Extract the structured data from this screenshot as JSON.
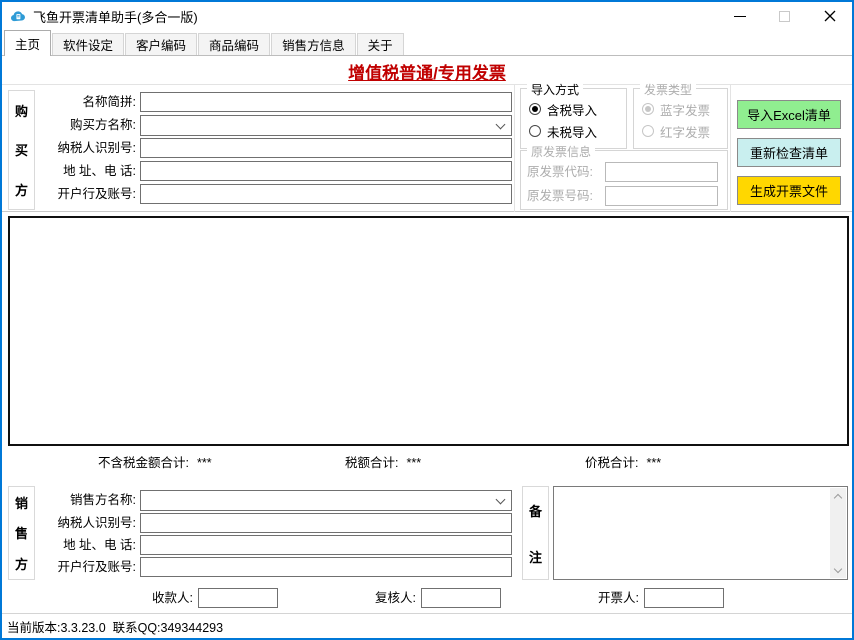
{
  "window": {
    "title": "飞鱼开票清单助手(多合一版)"
  },
  "colors": {
    "accent_border": "#0078D7",
    "heading_red": "#C00000",
    "button_green": "#90EE90",
    "button_cyan": "#C9EFEF",
    "button_gold": "#FFD700"
  },
  "tabs": [
    {
      "label": "主页",
      "active": true
    },
    {
      "label": "软件设定",
      "active": false
    },
    {
      "label": "客户编码",
      "active": false
    },
    {
      "label": "商品编码",
      "active": false
    },
    {
      "label": "销售方信息",
      "active": false
    },
    {
      "label": "关于",
      "active": false
    }
  ],
  "main": {
    "heading": "增值税普通/专用发票",
    "buyer": {
      "side_chars": [
        "购",
        "买",
        "方"
      ],
      "fields": [
        {
          "label": "名称简拼:",
          "value": ""
        },
        {
          "label": "购买方名称:",
          "value": ""
        },
        {
          "label": "纳税人识别号:",
          "value": ""
        },
        {
          "label": "地 址、电 话:",
          "value": ""
        },
        {
          "label": "开户行及账号:",
          "value": ""
        }
      ]
    },
    "import_mode": {
      "title": "导入方式",
      "options": [
        {
          "label": "含税导入",
          "selected": true
        },
        {
          "label": "未税导入",
          "selected": false
        }
      ]
    },
    "invoice_type": {
      "title": "发票类型",
      "disabled": true,
      "options": [
        {
          "label": "蓝字发票",
          "selected": true
        },
        {
          "label": "红字发票",
          "selected": false
        }
      ]
    },
    "original_invoice": {
      "title": "原发票信息",
      "disabled": true,
      "fields": [
        {
          "label": "原发票代码:",
          "value": ""
        },
        {
          "label": "原发票号码:",
          "value": ""
        }
      ]
    },
    "buttons": [
      {
        "label": "导入Excel清单"
      },
      {
        "label": "重新检查清单"
      },
      {
        "label": "生成开票文件"
      }
    ],
    "totals": [
      {
        "label": "不含税金额合计:",
        "value": "***"
      },
      {
        "label": "税额合计:",
        "value": "***"
      },
      {
        "label": "价税合计:",
        "value": "***"
      }
    ],
    "seller": {
      "side_chars": [
        "销",
        "售",
        "方"
      ],
      "fields": [
        {
          "label": "销售方名称:",
          "value": ""
        },
        {
          "label": "纳税人识别号:",
          "value": ""
        },
        {
          "label": "地 址、电 话:",
          "value": ""
        },
        {
          "label": "开户行及账号:",
          "value": ""
        }
      ]
    },
    "remark": {
      "side_chars": [
        "备",
        "注"
      ],
      "value": ""
    },
    "signers": [
      {
        "label": "收款人:",
        "value": ""
      },
      {
        "label": "复核人:",
        "value": ""
      },
      {
        "label": "开票人:",
        "value": ""
      }
    ]
  },
  "statusbar": {
    "text": "当前版本:3.3.23.0  联系QQ:349344293"
  }
}
